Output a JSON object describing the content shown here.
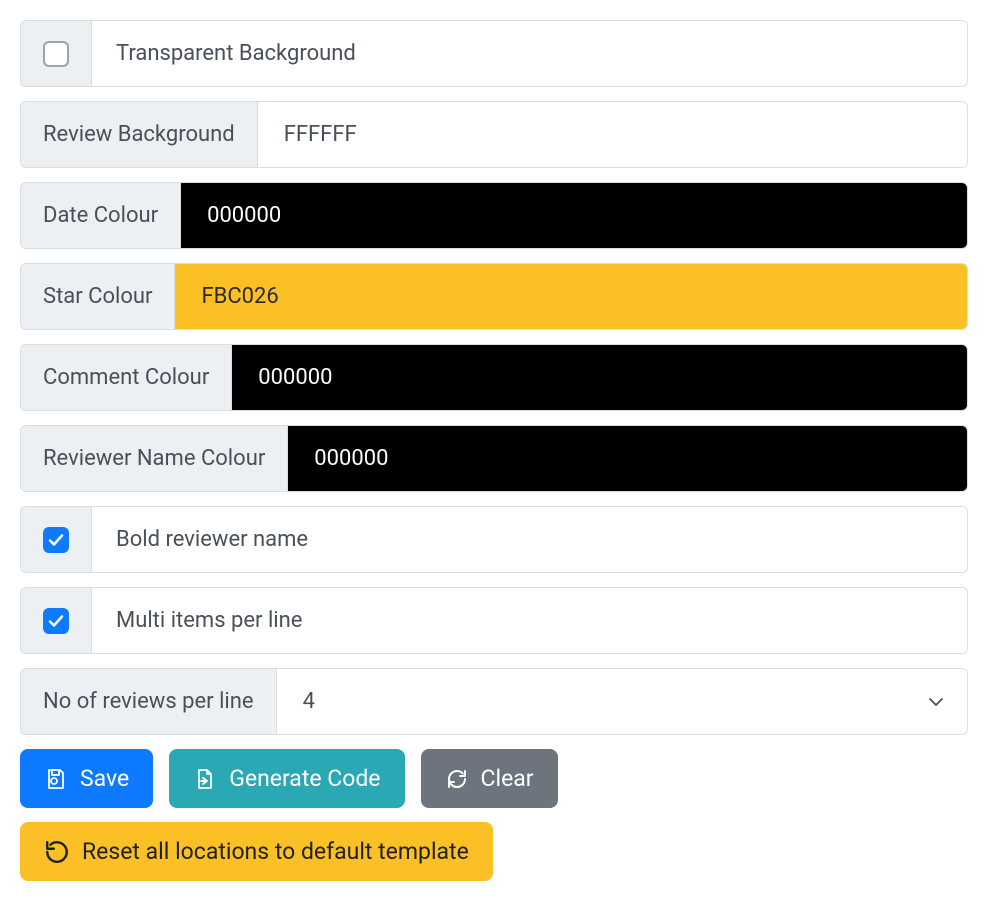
{
  "fields": {
    "transparent_bg": {
      "label": "Transparent Background",
      "checked": false
    },
    "review_bg": {
      "label": "Review Background",
      "value": "FFFFFF"
    },
    "date_colour": {
      "label": "Date Colour",
      "value": "000000"
    },
    "star_colour": {
      "label": "Star Colour",
      "value": "FBC026"
    },
    "comment_colour": {
      "label": "Comment Colour",
      "value": "000000"
    },
    "reviewer_name_colour": {
      "label": "Reviewer Name Colour",
      "value": "000000"
    },
    "bold_reviewer_name": {
      "label": "Bold reviewer name",
      "checked": true
    },
    "multi_items": {
      "label": "Multi items per line",
      "checked": true
    },
    "reviews_per_line": {
      "label": "No of reviews per line",
      "value": "4"
    }
  },
  "buttons": {
    "save": "Save",
    "generate_code": "Generate Code",
    "clear": "Clear",
    "reset": "Reset all locations to default template"
  },
  "colors": {
    "primary": "#0d7aff",
    "teal": "#2aa9b5",
    "gray": "#6c757d",
    "gold": "#fbc026"
  }
}
